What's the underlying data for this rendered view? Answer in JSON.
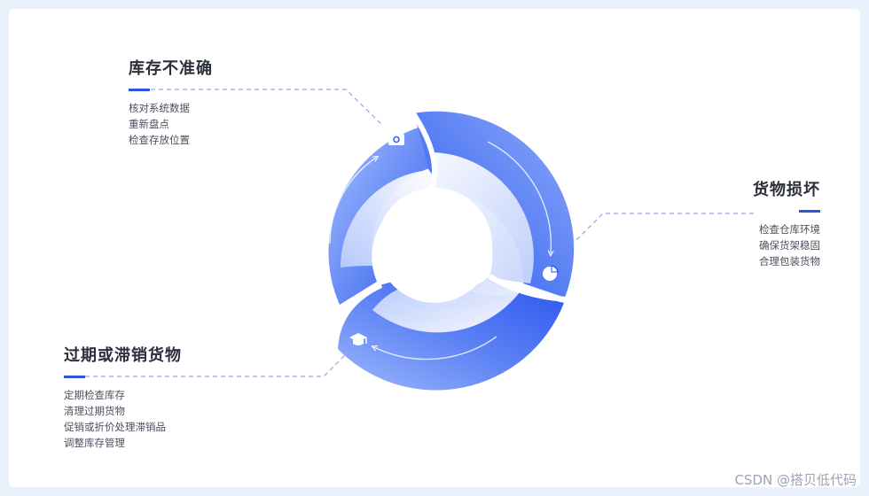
{
  "sections": [
    {
      "title": "库存不准确",
      "items": [
        "核对系统数据",
        "重新盘点",
        "检查存放位置"
      ],
      "icon": "camera-icon"
    },
    {
      "title": "货物损坏",
      "items": [
        "检查仓库环境",
        "确保货架稳固",
        "合理包装货物"
      ],
      "icon": "pie-chart-icon"
    },
    {
      "title": "过期或滞销货物",
      "items": [
        "定期检查库存",
        "清理过期货物",
        "促销或折价处理滞销品",
        "调整库存管理"
      ],
      "icon": "graduation-cap-icon"
    }
  ],
  "watermark": "CSDN @搭贝低代码",
  "colors": {
    "accent": "#2f55e4",
    "ring_dark": "#2a55ee",
    "ring_light": "#a6bdfb",
    "dash": "#8fa6e0"
  }
}
